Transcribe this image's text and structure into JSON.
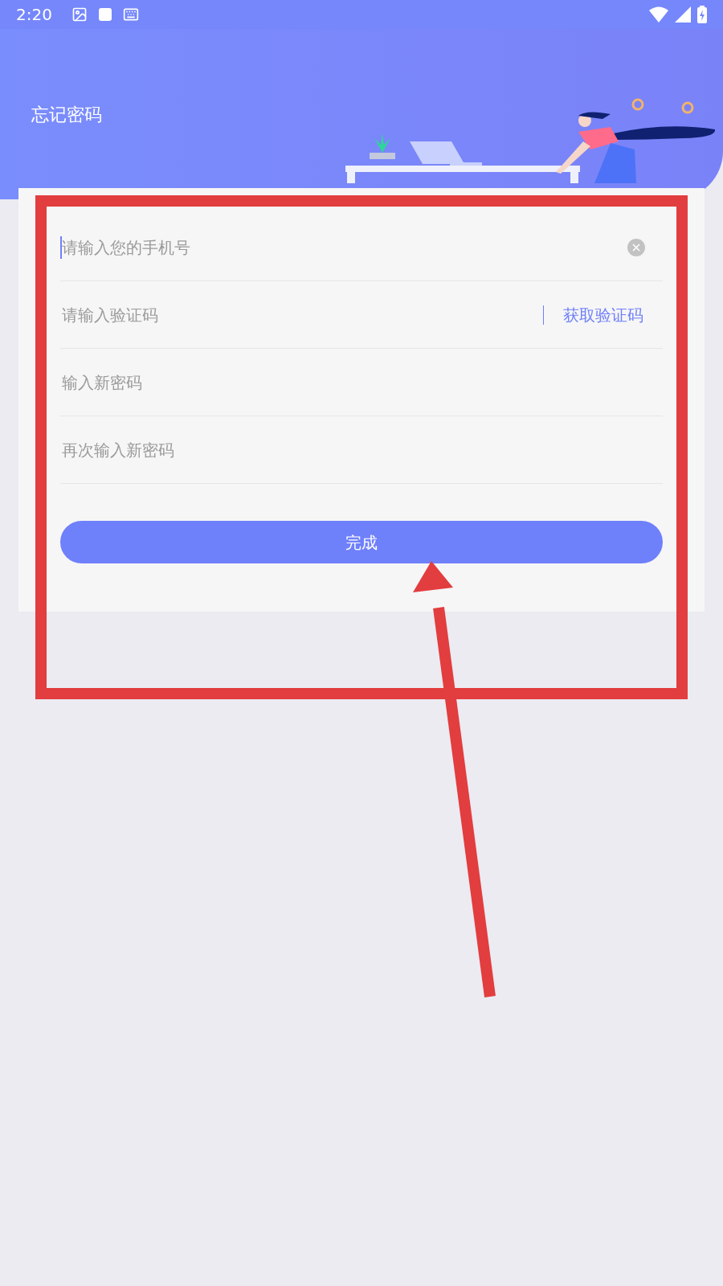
{
  "status_bar": {
    "time": "2:20"
  },
  "header": {
    "title": "忘记密码"
  },
  "fields": [
    {
      "placeholder": "请输入您的手机号",
      "focused": true
    },
    {
      "placeholder": "请输入验证码",
      "focused": false,
      "action": "获取验证码"
    },
    {
      "placeholder": "输入新密码",
      "focused": false
    },
    {
      "placeholder": "再次输入新密码",
      "focused": false
    }
  ],
  "submit_button": "完成"
}
